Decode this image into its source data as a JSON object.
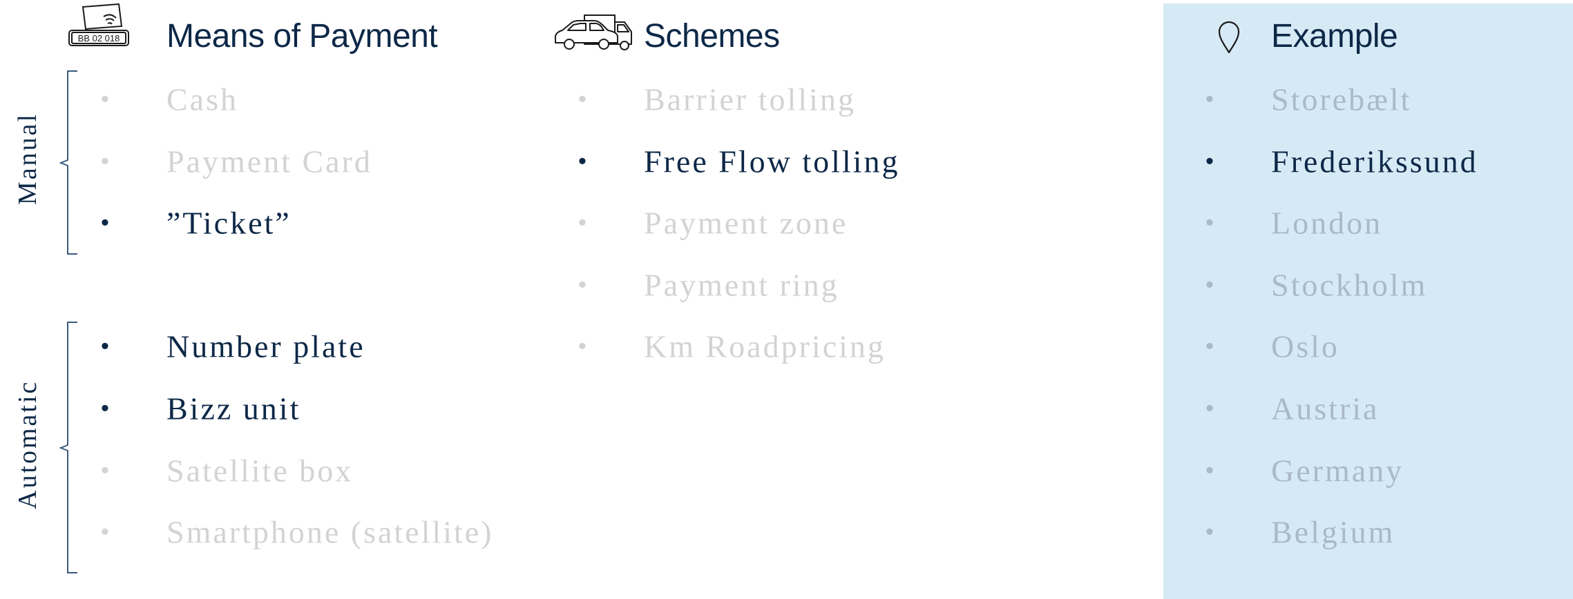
{
  "means": {
    "title": "Means of Payment",
    "plate_text": "BB 02 018",
    "groups": {
      "manual": "Manual",
      "automatic": "Automatic"
    },
    "items": [
      {
        "label": "Cash",
        "active": false
      },
      {
        "label": "Payment Card",
        "active": false
      },
      {
        "label": "”Ticket”",
        "active": true
      },
      {
        "label": "Number plate",
        "active": true
      },
      {
        "label": "Bizz unit",
        "active": true
      },
      {
        "label": "Satellite box",
        "active": false
      },
      {
        "label": "Smartphone (satellite)",
        "active": false
      }
    ]
  },
  "schemes": {
    "title": "Schemes",
    "items": [
      {
        "label": "Barrier tolling",
        "active": false
      },
      {
        "label": "Free Flow tolling",
        "active": true
      },
      {
        "label": "Payment zone",
        "active": false
      },
      {
        "label": "Payment ring",
        "active": false
      },
      {
        "label": "Km Roadpricing",
        "active": false
      }
    ]
  },
  "example": {
    "title": "Example",
    "items": [
      {
        "label": "Storebælt",
        "active": false
      },
      {
        "label": "Frederikssund",
        "active": true
      },
      {
        "label": "London",
        "active": false
      },
      {
        "label": "Stockholm",
        "active": false
      },
      {
        "label": "Oslo",
        "active": false
      },
      {
        "label": "Austria",
        "active": false
      },
      {
        "label": "Germany",
        "active": false
      },
      {
        "label": "Belgium",
        "active": false
      }
    ]
  },
  "bullet_char": "•",
  "colors": {
    "active": "#0d2847",
    "inactive": "#d3d3d3",
    "inactive_on_panel": "#aab9c7",
    "panel": "#d6eaf6"
  },
  "icons": {
    "means": "card-plate-icon",
    "schemes": "car-truck-icon",
    "example": "location-pin-icon"
  }
}
